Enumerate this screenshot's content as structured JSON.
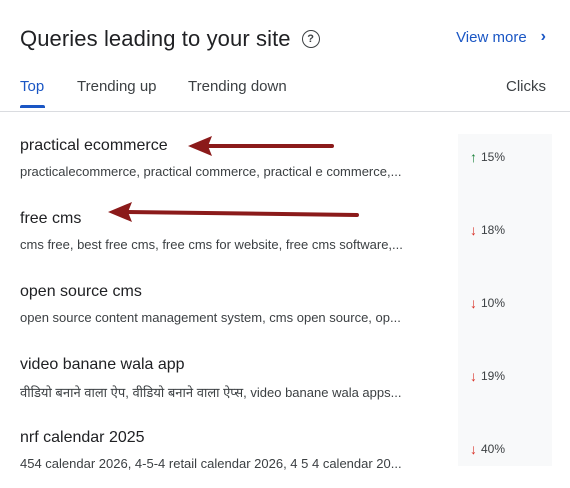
{
  "header": {
    "title": "Queries leading to your site",
    "help_icon": "help-circle-icon",
    "view_more_label": "View more",
    "view_more_icon": "chevron-right-icon"
  },
  "tabs": [
    {
      "label": "Top",
      "active": true
    },
    {
      "label": "Trending up",
      "active": false
    },
    {
      "label": "Trending down",
      "active": false
    }
  ],
  "column_header": "Clicks",
  "rows": [
    {
      "query": "practical ecommerce",
      "related": "practicalecommerce, practical commerce, practical e commerce,...",
      "direction": "up",
      "change": "15%"
    },
    {
      "query": "free cms",
      "related": "cms free, best free cms, free cms for website, free cms software,...",
      "direction": "down",
      "change": "18%"
    },
    {
      "query": "open source cms",
      "related": "open source content management system, cms open source, op...",
      "direction": "down",
      "change": "10%"
    },
    {
      "query": "video banane wala app",
      "related": "वीडियो बनाने वाला ऐप, वीडियो बनाने वाला ऐप्स, video banane wala apps...",
      "direction": "down",
      "change": "19%"
    },
    {
      "query": "nrf calendar 2025",
      "related": "454 calendar 2026, 4-5-4 retail calendar 2026, 4 5 4 calendar 20...",
      "direction": "down",
      "change": "40%"
    }
  ],
  "glyphs": {
    "up": "↑",
    "down": "↓"
  },
  "colors": {
    "accent": "#1a56c4",
    "up": "#188038",
    "down": "#d93025",
    "annotation_arrow": "#8b1a1a"
  }
}
